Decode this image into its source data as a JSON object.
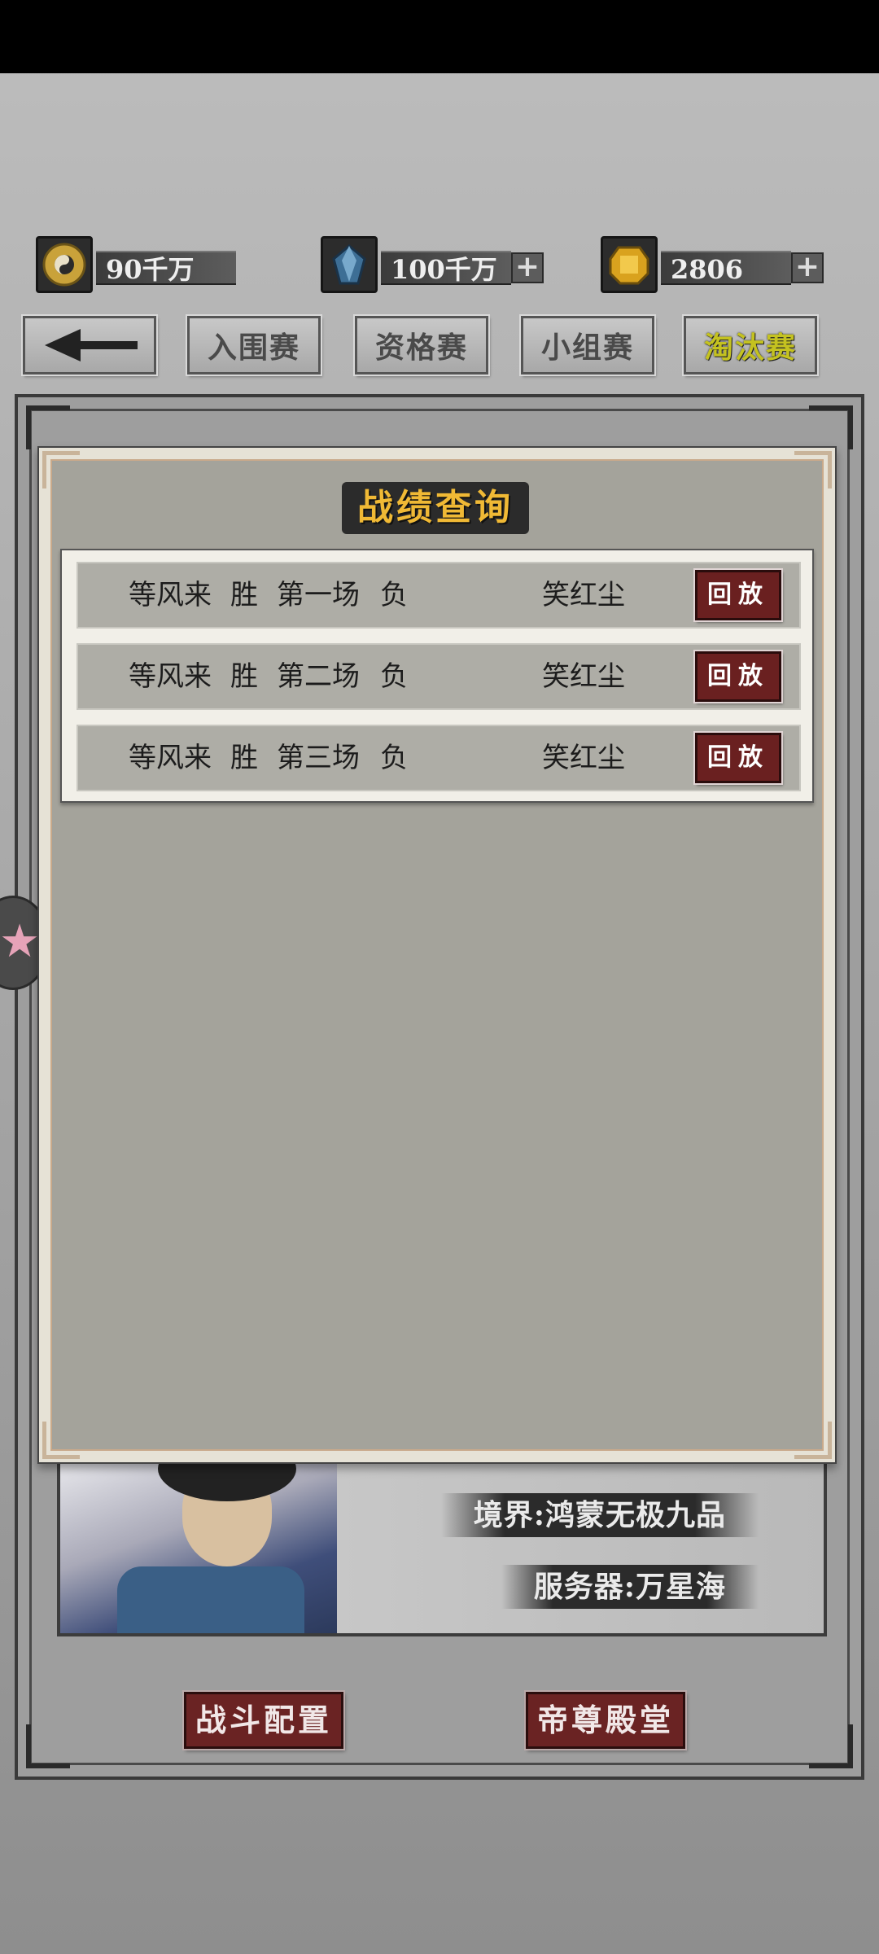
{
  "currencies": [
    {
      "icon": "taiji-coin-icon",
      "value": "90千万",
      "has_plus": false
    },
    {
      "icon": "blue-crystal-icon",
      "value": "100千万",
      "has_plus": true
    },
    {
      "icon": "gold-gem-icon",
      "value": "2806",
      "has_plus": true
    }
  ],
  "tabs": {
    "back": "back-arrow-icon",
    "items": [
      "入围赛",
      "资格赛",
      "小组赛",
      "淘汰赛"
    ],
    "active": "淘汰赛"
  },
  "modal": {
    "title": "战绩查询",
    "records": [
      {
        "player_left": "等风来",
        "left_result": "胜",
        "round": "第一场",
        "right_result": "负",
        "player_right": "笑红尘",
        "action": "回放"
      },
      {
        "player_left": "等风来",
        "left_result": "胜",
        "round": "第二场",
        "right_result": "负",
        "player_right": "笑红尘",
        "action": "回放"
      },
      {
        "player_left": "等风来",
        "left_result": "胜",
        "round": "第三场",
        "right_result": "负",
        "player_right": "笑红尘",
        "action": "回放"
      }
    ]
  },
  "hero": {
    "realm": "境界:鸿蒙无极九品",
    "server": "服务器:万星海"
  },
  "bottom_buttons": {
    "battle_config": "战斗配置",
    "emperor_hall": "帝尊殿堂"
  },
  "colors": {
    "accent_red": "#6a2020",
    "title_gold": "#f0b935",
    "active_tab": "#c4c220"
  }
}
